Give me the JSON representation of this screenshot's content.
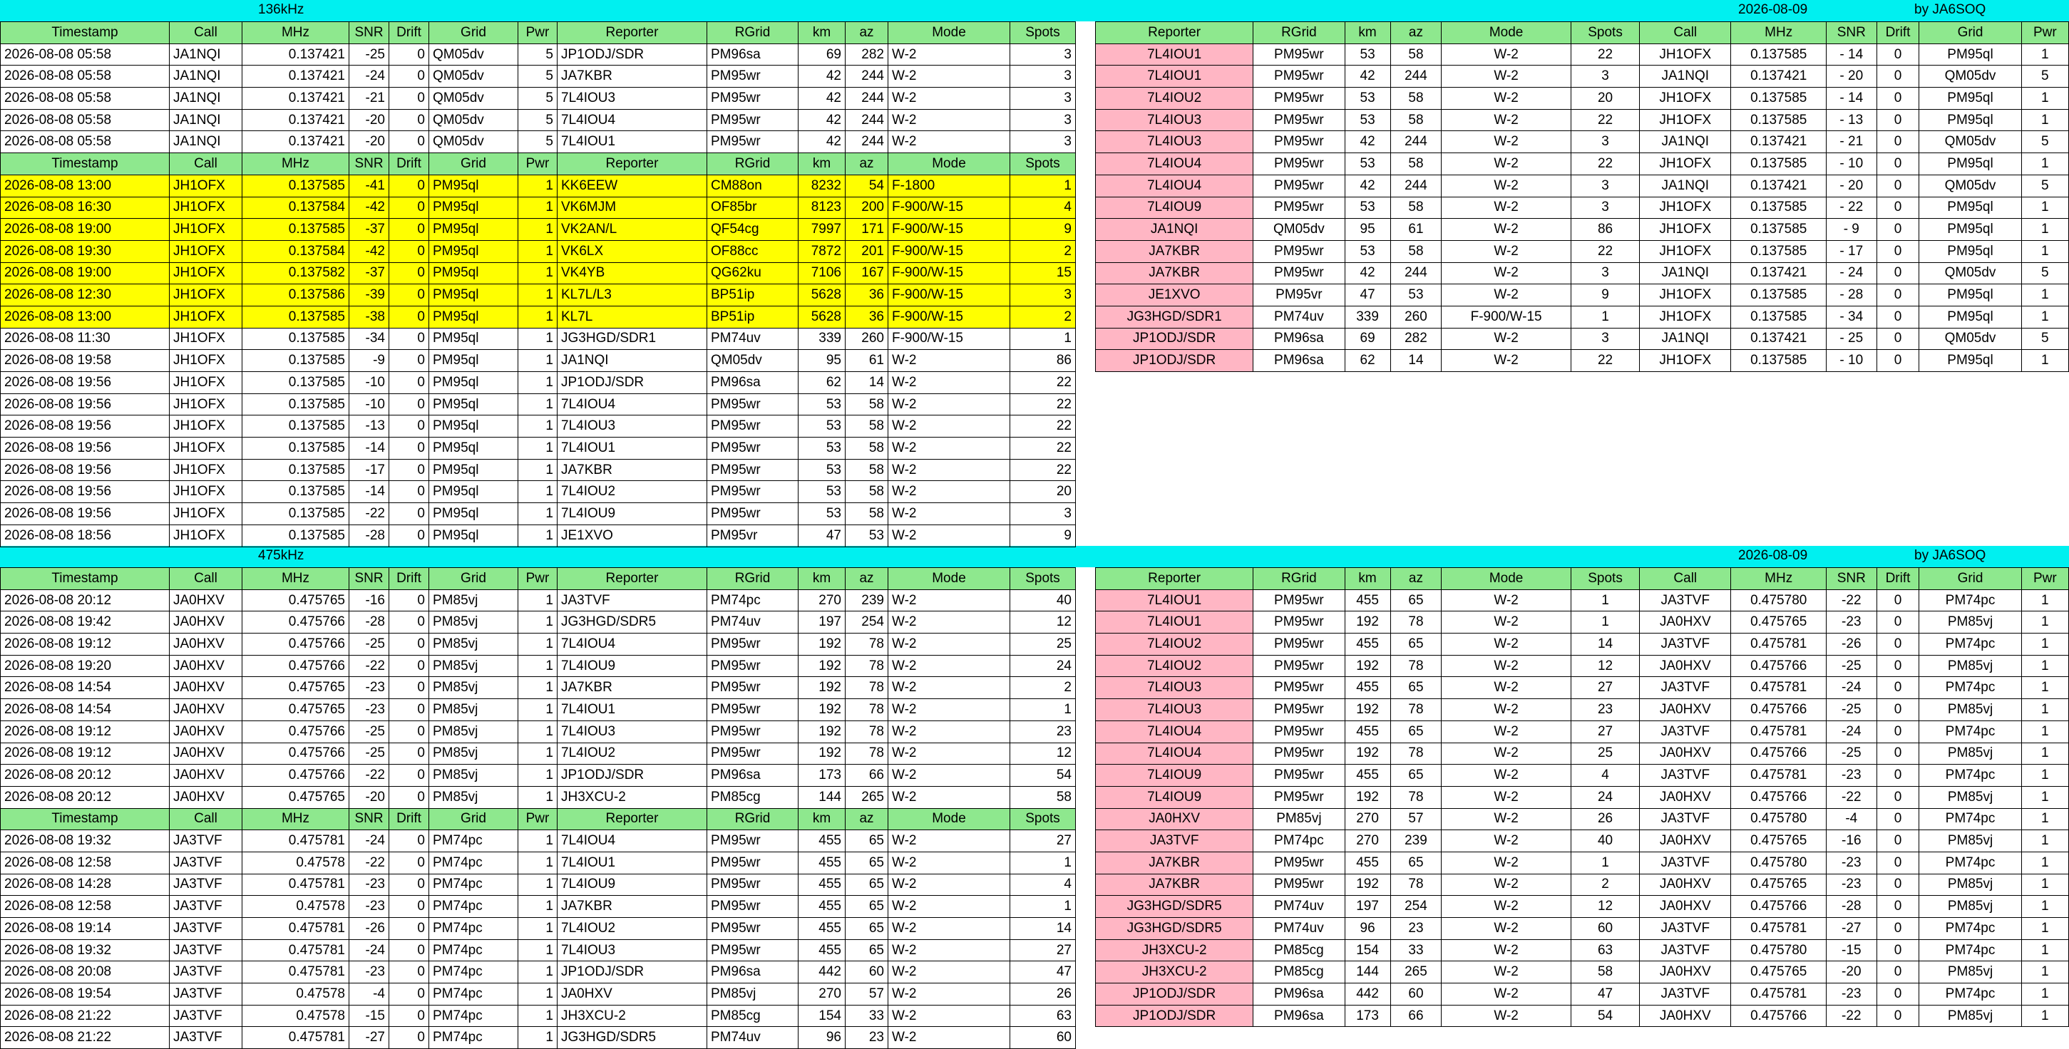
{
  "band136": {
    "label": "136kHz",
    "date": "2026-08-09",
    "by": "by JA6SOQ"
  },
  "band475": {
    "label": "475kHz",
    "date": "2026-08-09",
    "by": "by JA6SOQ"
  },
  "left_headers": [
    "Timestamp",
    "Call",
    "MHz",
    "SNR",
    "Drift",
    "Grid",
    "Pwr",
    "Reporter",
    "RGrid",
    "km",
    "az",
    "Mode",
    "Spots"
  ],
  "right_headers": [
    "Reporter",
    "RGrid",
    "km",
    "az",
    "Mode",
    "Spots",
    "Call",
    "MHz",
    "SNR",
    "Drift",
    "Grid",
    "Pwr"
  ],
  "t136": {
    "block1": [
      [
        "2026-08-08 05:58",
        "JA1NQI",
        "0.137421",
        "-25",
        "0",
        "QM05dv",
        "5",
        "JP1ODJ/SDR",
        "PM96sa",
        "69",
        "282",
        "W-2",
        "3"
      ],
      [
        "2026-08-08 05:58",
        "JA1NQI",
        "0.137421",
        "-24",
        "0",
        "QM05dv",
        "5",
        "JA7KBR",
        "PM95wr",
        "42",
        "244",
        "W-2",
        "3"
      ],
      [
        "2026-08-08 05:58",
        "JA1NQI",
        "0.137421",
        "-21",
        "0",
        "QM05dv",
        "5",
        "7L4IOU3",
        "PM95wr",
        "42",
        "244",
        "W-2",
        "3"
      ],
      [
        "2026-08-08 05:58",
        "JA1NQI",
        "0.137421",
        "-20",
        "0",
        "QM05dv",
        "5",
        "7L4IOU4",
        "PM95wr",
        "42",
        "244",
        "W-2",
        "3"
      ],
      [
        "2026-08-08 05:58",
        "JA1NQI",
        "0.137421",
        "-20",
        "0",
        "QM05dv",
        "5",
        "7L4IOU1",
        "PM95wr",
        "42",
        "244",
        "W-2",
        "3"
      ]
    ],
    "block2_hl": [
      [
        "2026-08-08 13:00",
        "JH1OFX",
        "0.137585",
        "-41",
        "0",
        "PM95ql",
        "1",
        "KK6EEW",
        "CM88on",
        "8232",
        "54",
        "F-1800",
        "1"
      ],
      [
        "2026-08-08 16:30",
        "JH1OFX",
        "0.137584",
        "-42",
        "0",
        "PM95ql",
        "1",
        "VK6MJM",
        "OF85br",
        "8123",
        "200",
        "F-900/W-15",
        "4"
      ],
      [
        "2026-08-08 19:00",
        "JH1OFX",
        "0.137585",
        "-37",
        "0",
        "PM95ql",
        "1",
        "VK2AN/L",
        "QF54cg",
        "7997",
        "171",
        "F-900/W-15",
        "9"
      ],
      [
        "2026-08-08 19:30",
        "JH1OFX",
        "0.137584",
        "-42",
        "0",
        "PM95ql",
        "1",
        "VK6LX",
        "OF88cc",
        "7872",
        "201",
        "F-900/W-15",
        "2"
      ],
      [
        "2026-08-08 19:00",
        "JH1OFX",
        "0.137582",
        "-37",
        "0",
        "PM95ql",
        "1",
        "VK4YB",
        "QG62ku",
        "7106",
        "167",
        "F-900/W-15",
        "15"
      ],
      [
        "2026-08-08 12:30",
        "JH1OFX",
        "0.137586",
        "-39",
        "0",
        "PM95ql",
        "1",
        "KL7L/L3",
        "BP51ip",
        "5628",
        "36",
        "F-900/W-15",
        "3"
      ],
      [
        "2026-08-08 13:00",
        "JH1OFX",
        "0.137585",
        "-38",
        "0",
        "PM95ql",
        "1",
        "KL7L",
        "BP51ip",
        "5628",
        "36",
        "F-900/W-15",
        "2"
      ]
    ],
    "block2": [
      [
        "2026-08-08 11:30",
        "JH1OFX",
        "0.137585",
        "-34",
        "0",
        "PM95ql",
        "1",
        "JG3HGD/SDR1",
        "PM74uv",
        "339",
        "260",
        "F-900/W-15",
        "1"
      ],
      [
        "2026-08-08 19:58",
        "JH1OFX",
        "0.137585",
        "-9",
        "0",
        "PM95ql",
        "1",
        "JA1NQI",
        "QM05dv",
        "95",
        "61",
        "W-2",
        "86"
      ],
      [
        "2026-08-08 19:56",
        "JH1OFX",
        "0.137585",
        "-10",
        "0",
        "PM95ql",
        "1",
        "JP1ODJ/SDR",
        "PM96sa",
        "62",
        "14",
        "W-2",
        "22"
      ],
      [
        "2026-08-08 19:56",
        "JH1OFX",
        "0.137585",
        "-10",
        "0",
        "PM95ql",
        "1",
        "7L4IOU4",
        "PM95wr",
        "53",
        "58",
        "W-2",
        "22"
      ],
      [
        "2026-08-08 19:56",
        "JH1OFX",
        "0.137585",
        "-13",
        "0",
        "PM95ql",
        "1",
        "7L4IOU3",
        "PM95wr",
        "53",
        "58",
        "W-2",
        "22"
      ],
      [
        "2026-08-08 19:56",
        "JH1OFX",
        "0.137585",
        "-14",
        "0",
        "PM95ql",
        "1",
        "7L4IOU1",
        "PM95wr",
        "53",
        "58",
        "W-2",
        "22"
      ],
      [
        "2026-08-08 19:56",
        "JH1OFX",
        "0.137585",
        "-17",
        "0",
        "PM95ql",
        "1",
        "JA7KBR",
        "PM95wr",
        "53",
        "58",
        "W-2",
        "22"
      ],
      [
        "2026-08-08 19:56",
        "JH1OFX",
        "0.137585",
        "-14",
        "0",
        "PM95ql",
        "1",
        "7L4IOU2",
        "PM95wr",
        "53",
        "58",
        "W-2",
        "20"
      ],
      [
        "2026-08-08 19:56",
        "JH1OFX",
        "0.137585",
        "-22",
        "0",
        "PM95ql",
        "1",
        "7L4IOU9",
        "PM95wr",
        "53",
        "58",
        "W-2",
        "3"
      ],
      [
        "2026-08-08 18:56",
        "JH1OFX",
        "0.137585",
        "-28",
        "0",
        "PM95ql",
        "1",
        "JE1XVO",
        "PM95vr",
        "47",
        "53",
        "W-2",
        "9"
      ]
    ]
  },
  "r136": [
    [
      "7L4IOU1",
      "PM95wr",
      "53",
      "58",
      "W-2",
      "22",
      "JH1OFX",
      "0.137585",
      "- 14",
      "0",
      "PM95ql",
      "1"
    ],
    [
      "7L4IOU1",
      "PM95wr",
      "42",
      "244",
      "W-2",
      "3",
      "JA1NQI",
      "0.137421",
      "- 20",
      "0",
      "QM05dv",
      "5"
    ],
    [
      "7L4IOU2",
      "PM95wr",
      "53",
      "58",
      "W-2",
      "20",
      "JH1OFX",
      "0.137585",
      "- 14",
      "0",
      "PM95ql",
      "1"
    ],
    [
      "7L4IOU3",
      "PM95wr",
      "53",
      "58",
      "W-2",
      "22",
      "JH1OFX",
      "0.137585",
      "- 13",
      "0",
      "PM95ql",
      "1"
    ],
    [
      "7L4IOU3",
      "PM95wr",
      "42",
      "244",
      "W-2",
      "3",
      "JA1NQI",
      "0.137421",
      "- 21",
      "0",
      "QM05dv",
      "5"
    ],
    [
      "7L4IOU4",
      "PM95wr",
      "53",
      "58",
      "W-2",
      "22",
      "JH1OFX",
      "0.137585",
      "- 10",
      "0",
      "PM95ql",
      "1"
    ],
    [
      "7L4IOU4",
      "PM95wr",
      "42",
      "244",
      "W-2",
      "3",
      "JA1NQI",
      "0.137421",
      "- 20",
      "0",
      "QM05dv",
      "5"
    ],
    [
      "7L4IOU9",
      "PM95wr",
      "53",
      "58",
      "W-2",
      "3",
      "JH1OFX",
      "0.137585",
      "- 22",
      "0",
      "PM95ql",
      "1"
    ],
    [
      "JA1NQI",
      "QM05dv",
      "95",
      "61",
      "W-2",
      "86",
      "JH1OFX",
      "0.137585",
      "- 9",
      "0",
      "PM95ql",
      "1"
    ],
    [
      "JA7KBR",
      "PM95wr",
      "53",
      "58",
      "W-2",
      "22",
      "JH1OFX",
      "0.137585",
      "- 17",
      "0",
      "PM95ql",
      "1"
    ],
    [
      "JA7KBR",
      "PM95wr",
      "42",
      "244",
      "W-2",
      "3",
      "JA1NQI",
      "0.137421",
      "- 24",
      "0",
      "QM05dv",
      "5"
    ],
    [
      "JE1XVO",
      "PM95vr",
      "47",
      "53",
      "W-2",
      "9",
      "JH1OFX",
      "0.137585",
      "- 28",
      "0",
      "PM95ql",
      "1"
    ],
    [
      "JG3HGD/SDR1",
      "PM74uv",
      "339",
      "260",
      "F-900/W-15",
      "1",
      "JH1OFX",
      "0.137585",
      "- 34",
      "0",
      "PM95ql",
      "1"
    ],
    [
      "JP1ODJ/SDR",
      "PM96sa",
      "69",
      "282",
      "W-2",
      "3",
      "JA1NQI",
      "0.137421",
      "- 25",
      "0",
      "QM05dv",
      "5"
    ],
    [
      "JP1ODJ/SDR",
      "PM96sa",
      "62",
      "14",
      "W-2",
      "22",
      "JH1OFX",
      "0.137585",
      "- 10",
      "0",
      "PM95ql",
      "1"
    ]
  ],
  "t475": {
    "block1": [
      [
        "2026-08-08 20:12",
        "JA0HXV",
        "0.475765",
        "-16",
        "0",
        "PM85vj",
        "1",
        "JA3TVF",
        "PM74pc",
        "270",
        "239",
        "W-2",
        "40"
      ],
      [
        "2026-08-08 19:42",
        "JA0HXV",
        "0.475766",
        "-28",
        "0",
        "PM85vj",
        "1",
        "JG3HGD/SDR5",
        "PM74uv",
        "197",
        "254",
        "W-2",
        "12"
      ],
      [
        "2026-08-08 19:12",
        "JA0HXV",
        "0.475766",
        "-25",
        "0",
        "PM85vj",
        "1",
        "7L4IOU4",
        "PM95wr",
        "192",
        "78",
        "W-2",
        "25"
      ],
      [
        "2026-08-08 19:20",
        "JA0HXV",
        "0.475766",
        "-22",
        "0",
        "PM85vj",
        "1",
        "7L4IOU9",
        "PM95wr",
        "192",
        "78",
        "W-2",
        "24"
      ],
      [
        "2026-08-08 14:54",
        "JA0HXV",
        "0.475765",
        "-23",
        "0",
        "PM85vj",
        "1",
        "JA7KBR",
        "PM95wr",
        "192",
        "78",
        "W-2",
        "2"
      ],
      [
        "2026-08-08 14:54",
        "JA0HXV",
        "0.475765",
        "-23",
        "0",
        "PM85vj",
        "1",
        "7L4IOU1",
        "PM95wr",
        "192",
        "78",
        "W-2",
        "1"
      ],
      [
        "2026-08-08 19:12",
        "JA0HXV",
        "0.475766",
        "-25",
        "0",
        "PM85vj",
        "1",
        "7L4IOU3",
        "PM95wr",
        "192",
        "78",
        "W-2",
        "23"
      ],
      [
        "2026-08-08 19:12",
        "JA0HXV",
        "0.475766",
        "-25",
        "0",
        "PM85vj",
        "1",
        "7L4IOU2",
        "PM95wr",
        "192",
        "78",
        "W-2",
        "12"
      ],
      [
        "2026-08-08 20:12",
        "JA0HXV",
        "0.475766",
        "-22",
        "0",
        "PM85vj",
        "1",
        "JP1ODJ/SDR",
        "PM96sa",
        "173",
        "66",
        "W-2",
        "54"
      ],
      [
        "2026-08-08 20:12",
        "JA0HXV",
        "0.475765",
        "-20",
        "0",
        "PM85vj",
        "1",
        "JH3XCU-2",
        "PM85cg",
        "144",
        "265",
        "W-2",
        "58"
      ]
    ],
    "block2": [
      [
        "2026-08-08 19:32",
        "JA3TVF",
        "0.475781",
        "-24",
        "0",
        "PM74pc",
        "1",
        "7L4IOU4",
        "PM95wr",
        "455",
        "65",
        "W-2",
        "27"
      ],
      [
        "2026-08-08 12:58",
        "JA3TVF",
        "0.47578",
        "-22",
        "0",
        "PM74pc",
        "1",
        "7L4IOU1",
        "PM95wr",
        "455",
        "65",
        "W-2",
        "1"
      ],
      [
        "2026-08-08 14:28",
        "JA3TVF",
        "0.475781",
        "-23",
        "0",
        "PM74pc",
        "1",
        "7L4IOU9",
        "PM95wr",
        "455",
        "65",
        "W-2",
        "4"
      ],
      [
        "2026-08-08 12:58",
        "JA3TVF",
        "0.47578",
        "-23",
        "0",
        "PM74pc",
        "1",
        "JA7KBR",
        "PM95wr",
        "455",
        "65",
        "W-2",
        "1"
      ],
      [
        "2026-08-08 19:14",
        "JA3TVF",
        "0.475781",
        "-26",
        "0",
        "PM74pc",
        "1",
        "7L4IOU2",
        "PM95wr",
        "455",
        "65",
        "W-2",
        "14"
      ],
      [
        "2026-08-08 19:32",
        "JA3TVF",
        "0.475781",
        "-24",
        "0",
        "PM74pc",
        "1",
        "7L4IOU3",
        "PM95wr",
        "455",
        "65",
        "W-2",
        "27"
      ],
      [
        "2026-08-08 20:08",
        "JA3TVF",
        "0.475781",
        "-23",
        "0",
        "PM74pc",
        "1",
        "JP1ODJ/SDR",
        "PM96sa",
        "442",
        "60",
        "W-2",
        "47"
      ],
      [
        "2026-08-08 19:54",
        "JA3TVF",
        "0.47578",
        "-4",
        "0",
        "PM74pc",
        "1",
        "JA0HXV",
        "PM85vj",
        "270",
        "57",
        "W-2",
        "26"
      ],
      [
        "2026-08-08 21:22",
        "JA3TVF",
        "0.47578",
        "-15",
        "0",
        "PM74pc",
        "1",
        "JH3XCU-2",
        "PM85cg",
        "154",
        "33",
        "W-2",
        "63"
      ],
      [
        "2026-08-08 21:22",
        "JA3TVF",
        "0.475781",
        "-27",
        "0",
        "PM74pc",
        "1",
        "JG3HGD/SDR5",
        "PM74uv",
        "96",
        "23",
        "W-2",
        "60"
      ]
    ]
  },
  "r475": [
    [
      "7L4IOU1",
      "PM95wr",
      "455",
      "65",
      "W-2",
      "1",
      "JA3TVF",
      "0.475780",
      "-22",
      "0",
      "PM74pc",
      "1"
    ],
    [
      "7L4IOU1",
      "PM95wr",
      "192",
      "78",
      "W-2",
      "1",
      "JA0HXV",
      "0.475765",
      "-23",
      "0",
      "PM85vj",
      "1"
    ],
    [
      "7L4IOU2",
      "PM95wr",
      "455",
      "65",
      "W-2",
      "14",
      "JA3TVF",
      "0.475781",
      "-26",
      "0",
      "PM74pc",
      "1"
    ],
    [
      "7L4IOU2",
      "PM95wr",
      "192",
      "78",
      "W-2",
      "12",
      "JA0HXV",
      "0.475766",
      "-25",
      "0",
      "PM85vj",
      "1"
    ],
    [
      "7L4IOU3",
      "PM95wr",
      "455",
      "65",
      "W-2",
      "27",
      "JA3TVF",
      "0.475781",
      "-24",
      "0",
      "PM74pc",
      "1"
    ],
    [
      "7L4IOU3",
      "PM95wr",
      "192",
      "78",
      "W-2",
      "23",
      "JA0HXV",
      "0.475766",
      "-25",
      "0",
      "PM85vj",
      "1"
    ],
    [
      "7L4IOU4",
      "PM95wr",
      "455",
      "65",
      "W-2",
      "27",
      "JA3TVF",
      "0.475781",
      "-24",
      "0",
      "PM74pc",
      "1"
    ],
    [
      "7L4IOU4",
      "PM95wr",
      "192",
      "78",
      "W-2",
      "25",
      "JA0HXV",
      "0.475766",
      "-25",
      "0",
      "PM85vj",
      "1"
    ],
    [
      "7L4IOU9",
      "PM95wr",
      "455",
      "65",
      "W-2",
      "4",
      "JA3TVF",
      "0.475781",
      "-23",
      "0",
      "PM74pc",
      "1"
    ],
    [
      "7L4IOU9",
      "PM95wr",
      "192",
      "78",
      "W-2",
      "24",
      "JA0HXV",
      "0.475766",
      "-22",
      "0",
      "PM85vj",
      "1"
    ],
    [
      "JA0HXV",
      "PM85vj",
      "270",
      "57",
      "W-2",
      "26",
      "JA3TVF",
      "0.475780",
      "-4",
      "0",
      "PM74pc",
      "1"
    ],
    [
      "JA3TVF",
      "PM74pc",
      "270",
      "239",
      "W-2",
      "40",
      "JA0HXV",
      "0.475765",
      "-16",
      "0",
      "PM85vj",
      "1"
    ],
    [
      "JA7KBR",
      "PM95wr",
      "455",
      "65",
      "W-2",
      "1",
      "JA3TVF",
      "0.475780",
      "-23",
      "0",
      "PM74pc",
      "1"
    ],
    [
      "JA7KBR",
      "PM95wr",
      "192",
      "78",
      "W-2",
      "2",
      "JA0HXV",
      "0.475765",
      "-23",
      "0",
      "PM85vj",
      "1"
    ],
    [
      "JG3HGD/SDR5",
      "PM74uv",
      "197",
      "254",
      "W-2",
      "12",
      "JA0HXV",
      "0.475766",
      "-28",
      "0",
      "PM85vj",
      "1"
    ],
    [
      "JG3HGD/SDR5",
      "PM74uv",
      "96",
      "23",
      "W-2",
      "60",
      "JA3TVF",
      "0.475781",
      "-27",
      "0",
      "PM74pc",
      "1"
    ],
    [
      "JH3XCU-2",
      "PM85cg",
      "154",
      "33",
      "W-2",
      "63",
      "JA3TVF",
      "0.475780",
      "-15",
      "0",
      "PM74pc",
      "1"
    ],
    [
      "JH3XCU-2",
      "PM85cg",
      "144",
      "265",
      "W-2",
      "58",
      "JA0HXV",
      "0.475765",
      "-20",
      "0",
      "PM85vj",
      "1"
    ],
    [
      "JP1ODJ/SDR",
      "PM96sa",
      "442",
      "60",
      "W-2",
      "47",
      "JA3TVF",
      "0.475781",
      "-23",
      "0",
      "PM74pc",
      "1"
    ],
    [
      "JP1ODJ/SDR",
      "PM96sa",
      "173",
      "66",
      "W-2",
      "54",
      "JA0HXV",
      "0.475766",
      "-22",
      "0",
      "PM85vj",
      "1"
    ]
  ]
}
